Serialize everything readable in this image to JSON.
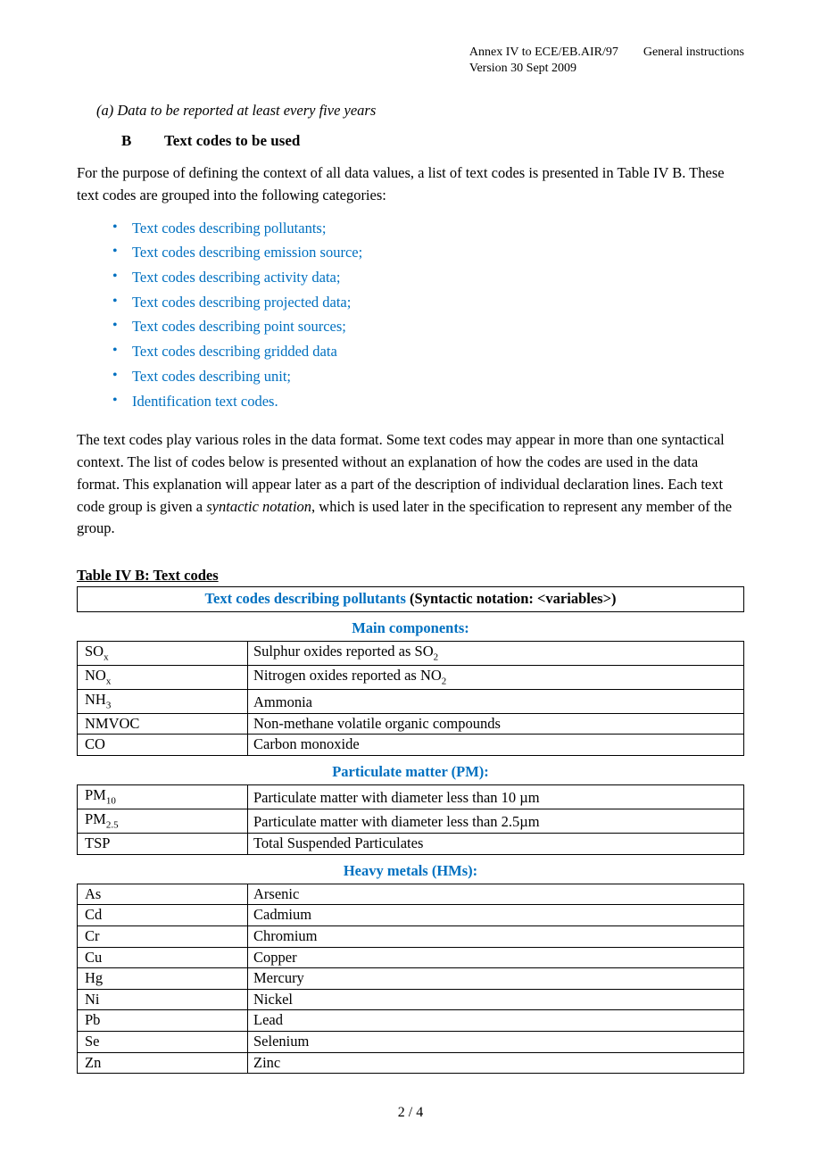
{
  "header": {
    "annex": "Annex IV to ECE/EB.AIR/97",
    "title": "General instructions",
    "version": "Version 30 Sept 2009"
  },
  "sectionA": "(a)  Data to be reported at least every five years",
  "sectionB": {
    "letter": "B",
    "title": "Text codes to be used"
  },
  "intro": "For the purpose of defining the context of all data values, a list of text codes is presented in Table IV B. These text codes are grouped into the following categories:",
  "bullets": [
    "Text codes describing pollutants;",
    "Text codes describing emission source;",
    "Text codes describing activity data;",
    "Text codes describing projected data;",
    "Text codes describing point sources;",
    "Text codes describing gridded data",
    "Text codes describing unit;",
    "Identification text codes."
  ],
  "para2_part1": "The text codes play various roles in the data format.  Some text codes may appear in more than one syntactical context. The list of codes below is presented without an explanation of how the codes are used in the data format.  This explanation will appear later as a part of the description of individual declaration lines.  Each text code group is given a ",
  "para2_em": "syntactic notation",
  "para2_part2": ", which is used later in the specification to represent any member of the group.",
  "tableTitle": "Table IV B: Text codes",
  "tableHeader": {
    "blue": "Text codes describing pollutants",
    "rest": " (Syntactic notation: <variables>)"
  },
  "groups": [
    {
      "subhead": "Main components:",
      "rows": [
        {
          "code": "SO",
          "sub": "x",
          "desc_pre": "Sulphur oxides reported as SO",
          "desc_sub": "2"
        },
        {
          "code": "NO",
          "sub": "x",
          "desc_pre": "Nitrogen oxides reported as NO",
          "desc_sub": "2"
        },
        {
          "code": "NH",
          "sub": "3",
          "desc": "Ammonia"
        },
        {
          "code": "NMVOC",
          "desc": "Non-methane volatile organic compounds"
        },
        {
          "code": "CO",
          "desc": "Carbon monoxide"
        }
      ]
    },
    {
      "subhead": "Particulate matter (PM):",
      "rows": [
        {
          "code": "PM",
          "sub": "10",
          "desc": "Particulate matter with diameter less than 10 µm"
        },
        {
          "code": "PM",
          "sub": "2.5",
          "desc": "Particulate matter with diameter less than 2.5µm"
        },
        {
          "code": "TSP",
          "desc": "Total Suspended Particulates"
        }
      ]
    },
    {
      "subhead": "Heavy metals (HMs):",
      "rows": [
        {
          "code": "As",
          "desc": "Arsenic"
        },
        {
          "code": "Cd",
          "desc": "Cadmium"
        },
        {
          "code": "Cr",
          "desc": "Chromium"
        },
        {
          "code": "Cu",
          "desc": "Copper"
        },
        {
          "code": "Hg",
          "desc": "Mercury"
        },
        {
          "code": "Ni",
          "desc": "Nickel"
        },
        {
          "code": "Pb",
          "desc": "Lead"
        },
        {
          "code": "Se",
          "desc": "Selenium"
        },
        {
          "code": "Zn",
          "desc": "Zinc"
        }
      ]
    }
  ],
  "footer": "2 / 4"
}
